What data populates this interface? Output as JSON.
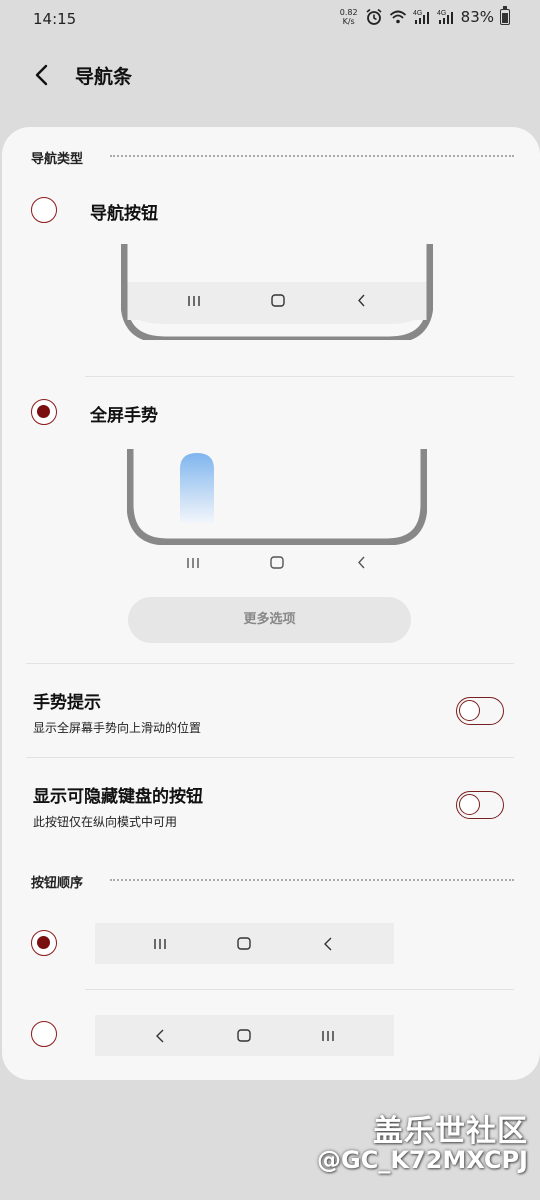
{
  "status": {
    "time": "14:15",
    "net_speed_value": "0.82",
    "net_speed_unit": "K/s",
    "battery": "83%",
    "icons": [
      "alarm-icon",
      "wifi-icon",
      "signal-4g-icon",
      "signal-4g-icon",
      "battery-icon"
    ]
  },
  "header": {
    "title": "导航条"
  },
  "nav_type": {
    "section_label": "导航类型",
    "options": [
      {
        "label": "导航按钮",
        "checked": false
      },
      {
        "label": "全屏手势",
        "checked": true
      }
    ],
    "more_options": "更多选项"
  },
  "settings": [
    {
      "title": "手势提示",
      "subtitle": "显示全屏幕手势向上滑动的位置",
      "on": false
    },
    {
      "title": "显示可隐藏键盘的按钮",
      "subtitle": "此按钮仅在纵向模式中可用",
      "on": false
    }
  ],
  "button_order": {
    "section_label": "按钮顺序",
    "options": [
      {
        "order": [
          "recent-apps-icon",
          "home-icon",
          "back-icon"
        ],
        "checked": true
      },
      {
        "order": [
          "back-icon",
          "home-icon",
          "recent-apps-icon"
        ],
        "checked": false
      }
    ]
  },
  "watermark": {
    "line1": "盖乐世社区",
    "line2": "@GC_K72MXCPJ"
  },
  "colors": {
    "accent": "#7a0f0f",
    "card": "#f7f7f7",
    "background": "#dcdcdc",
    "gesture_pill": "#7fb5ee"
  }
}
